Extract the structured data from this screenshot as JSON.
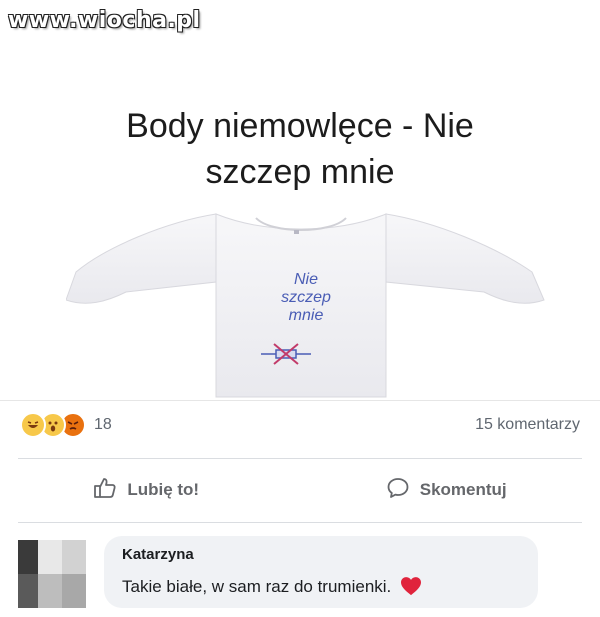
{
  "watermark": "www.wiocha.pl",
  "post": {
    "title_line1": "Body niemowlęce - Nie",
    "title_line2": "szczep mnie",
    "print": {
      "line1": "Nie",
      "line2": "szczep",
      "line3": "mnie"
    }
  },
  "stats": {
    "reaction_icons": [
      "haha-icon",
      "wow-icon",
      "angry-icon"
    ],
    "reaction_count": "18",
    "comments_count": "15 komentarzy"
  },
  "actions": {
    "like_label": "Lubię to!",
    "comment_label": "Skomentuj"
  },
  "comment": {
    "author": "Katarzyna",
    "text": "Takie białe, w sam raz do trumienki.",
    "emoji": "heart-icon"
  },
  "colors": {
    "print_text": "#4a5db5",
    "heart": "#e0243c",
    "angry": "#e9710f",
    "reaction_yellow": "#f7c84a"
  }
}
